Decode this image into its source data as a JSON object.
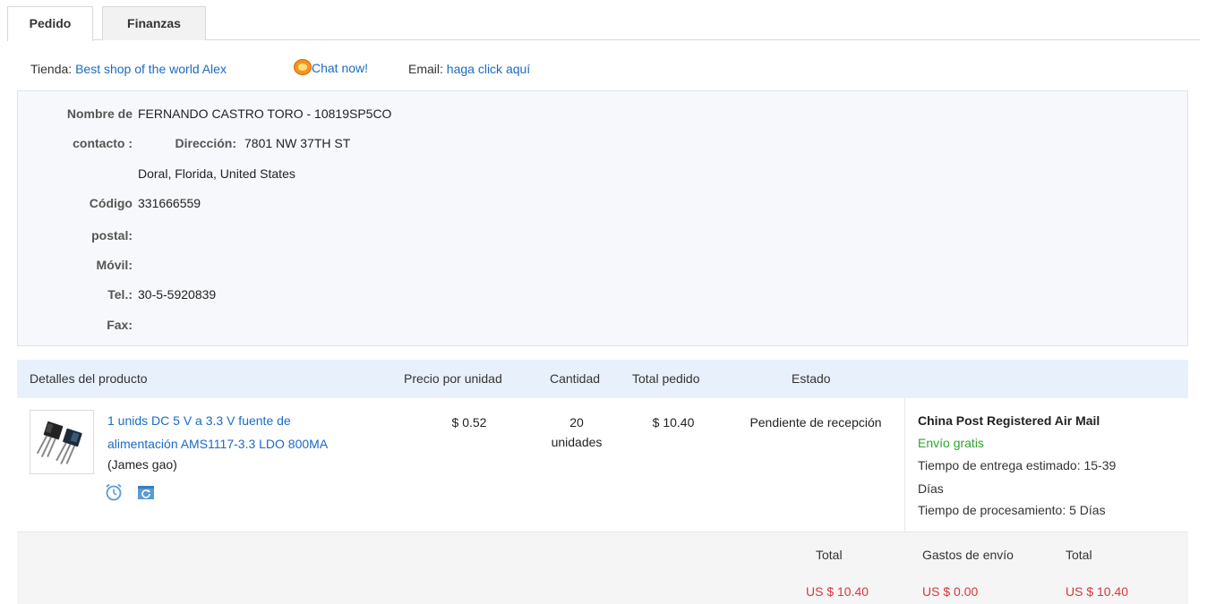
{
  "tabs": [
    {
      "label": "Pedido",
      "active": true
    },
    {
      "label": "Finanzas",
      "active": false
    }
  ],
  "store": {
    "label": "Tienda:",
    "name": "Best shop of the world Alex",
    "chat": "Chat now!",
    "email_label": "Email:",
    "email_link": "haga click aquí"
  },
  "contact": {
    "name_label_1": "Nombre de",
    "name_label_2": "contacto :",
    "name_value": "FERNANDO CASTRO TORO - 10819SP5CO",
    "address_label": "Dirección:",
    "address_line1": "7801 NW 37TH ST",
    "address_line2": "Doral, Florida, United States",
    "zip_label_1": "Código",
    "zip_label_2": "postal:",
    "zip_value": "331666559",
    "mobile_label": "Móvil:",
    "tel_label": "Tel.:",
    "tel_value": "30-5-5920839",
    "fax_label": "Fax:"
  },
  "table": {
    "headers": {
      "details": "Detalles del producto",
      "unit_price": "Precio por unidad",
      "quantity": "Cantidad",
      "order_total": "Total pedido",
      "status": "Estado"
    },
    "row": {
      "product_line1": "1 unids DC 5 V a 3.3 V fuente de",
      "product_line2": "alimentación AMS1117-3.3 LDO 800MA",
      "seller": "(James gao)",
      "unit_price": "$ 0.52",
      "quantity_num": "20",
      "quantity_unit": "unidades",
      "total": "$ 10.40",
      "status": "Pendiente de recepción",
      "shipping_method": "China Post Registered Air Mail",
      "shipping_cost": "Envío gratis",
      "eta_line1": "Tiempo de entrega estimado: 15-39",
      "eta_line2": "Días",
      "processing": "Tiempo de procesamiento: 5 Días"
    }
  },
  "totals": {
    "total_label": "Total",
    "shipping_label": "Gastos de envío",
    "grand_label": "Total",
    "total_value": "US $ 10.40",
    "shipping_value": "US $ 0.00",
    "grand_value": "US $ 10.40"
  },
  "colors": {
    "link": "#1a6bc4",
    "price_red": "#d9363e",
    "free_green": "#2ea52e",
    "header_bg": "#e8f1fb",
    "contact_bg": "#f6f8fb"
  }
}
